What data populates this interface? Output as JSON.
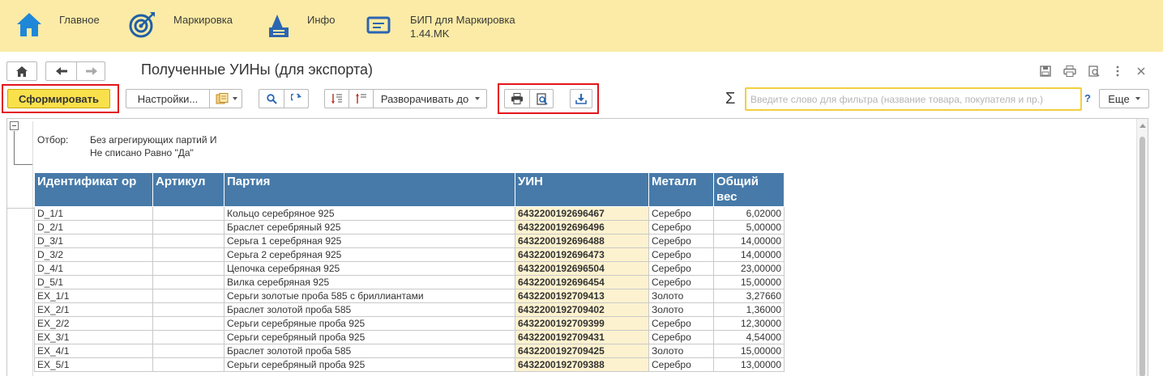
{
  "sections": [
    {
      "label": "Главное",
      "icon": "home-icon"
    },
    {
      "label": "Маркировка",
      "icon": "target-icon"
    },
    {
      "label": "Инфо",
      "icon": "info-bag-icon"
    },
    {
      "label": "БИП для Маркировка",
      "label2": "1.44.MK",
      "icon": "chat-icon"
    }
  ],
  "title": "Полученные УИНы (для экспорта)",
  "toolbar": {
    "generate": "Сформировать",
    "settings": "Настройки...",
    "expand": "Разворачивать до",
    "sigma": "Σ",
    "search_placeholder": "Введите слово для фильтра (название товара, покупателя и пр.)",
    "help": "?",
    "more": "Еще"
  },
  "filter": {
    "label": "Отбор:",
    "line1": "Без агрегирующих партий И",
    "line2": "Не списано Равно \"Да\""
  },
  "table": {
    "headers": {
      "id": "Идентификат ор",
      "article": "Артикул",
      "batch": "Партия",
      "uin": "УИН",
      "metal": "Металл",
      "weight": "Общий вес"
    },
    "rows": [
      {
        "id": "D_1/1",
        "article": "",
        "batch": "Кольцо серебряное 925",
        "uin": "6432200192696467",
        "metal": "Серебро",
        "weight": "6,02000"
      },
      {
        "id": "D_2/1",
        "article": "",
        "batch": "Браслет серебряный 925",
        "uin": "6432200192696496",
        "metal": "Серебро",
        "weight": "5,00000"
      },
      {
        "id": "D_3/1",
        "article": "",
        "batch": "Серьга 1 серебряная 925",
        "uin": "6432200192696488",
        "metal": "Серебро",
        "weight": "14,00000"
      },
      {
        "id": "D_3/2",
        "article": "",
        "batch": "Серьга 2 серебряная 925",
        "uin": "6432200192696473",
        "metal": "Серебро",
        "weight": "14,00000"
      },
      {
        "id": "D_4/1",
        "article": "",
        "batch": "Цепочка серебряная 925",
        "uin": "6432200192696504",
        "metal": "Серебро",
        "weight": "23,00000"
      },
      {
        "id": "D_5/1",
        "article": "",
        "batch": "Вилка серебряная 925",
        "uin": "6432200192696454",
        "metal": "Серебро",
        "weight": "15,00000"
      },
      {
        "id": "EX_1/1",
        "article": "",
        "batch": "Серьги золотые проба 585 с бриллиантами",
        "uin": "6432200192709413",
        "metal": "Золото",
        "weight": "3,27660"
      },
      {
        "id": "EX_2/1",
        "article": "",
        "batch": "Браслет золотой проба 585",
        "uin": "6432200192709402",
        "metal": "Золото",
        "weight": "1,36000"
      },
      {
        "id": "EX_2/2",
        "article": "",
        "batch": "Серьги серебряные проба 925",
        "uin": "6432200192709399",
        "metal": "Серебро",
        "weight": "12,30000"
      },
      {
        "id": "EX_3/1",
        "article": "",
        "batch": "Серьги серебряный проба 925",
        "uin": "6432200192709431",
        "metal": "Серебро",
        "weight": "4,54000"
      },
      {
        "id": "EX_4/1",
        "article": "",
        "batch": "Браслет золотой проба 585",
        "uin": "6432200192709425",
        "metal": "Золото",
        "weight": "15,00000"
      },
      {
        "id": "EX_5/1",
        "article": "",
        "batch": "Серьги серебряный проба 925",
        "uin": "6432200192709388",
        "metal": "Серебро",
        "weight": "13,00000"
      }
    ]
  },
  "colors": {
    "section_bar": "#fbeba6",
    "header": "#477aa9",
    "uin_cell": "#fdf2cf",
    "highlight": "#e3141b",
    "primary": "#f9e14c"
  }
}
